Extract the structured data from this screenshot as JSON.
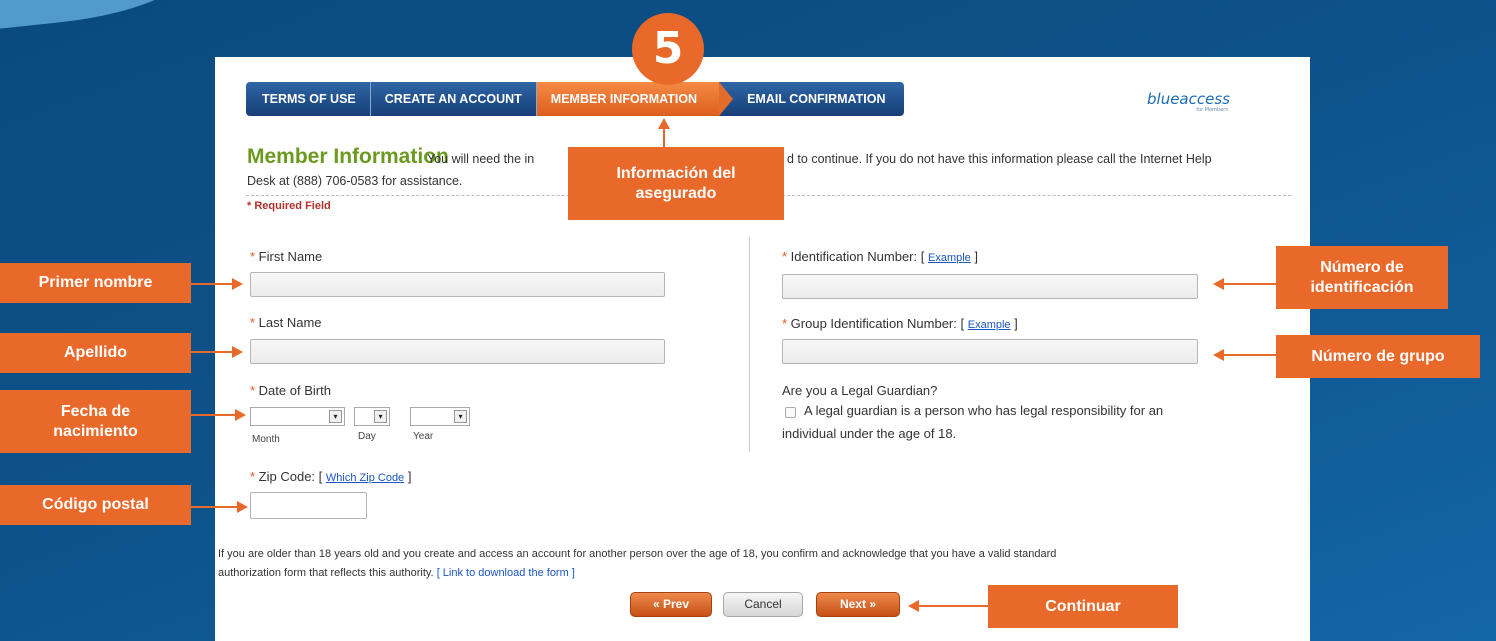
{
  "step": {
    "number": "5"
  },
  "tabs": [
    {
      "label": "TERMS OF USE"
    },
    {
      "label": "CREATE AN ACCOUNT"
    },
    {
      "label": "MEMBER INFORMATION"
    },
    {
      "label": "EMAIL CONFIRMATION"
    }
  ],
  "logo": {
    "text": "blueaccess",
    "tagline": "for Members"
  },
  "header": {
    "title": "Member Information",
    "intro_part1": "You will need the in",
    "intro_part2": "d to continue. If you do not have this information please call the Internet Help",
    "intro_line2": "Desk at (888) 706-0583 for assistance.",
    "required_note": "* Required Field"
  },
  "form": {
    "first_name_label": "First Name",
    "last_name_label": "Last Name",
    "dob_label": "Date of Birth",
    "dob_month": "Month",
    "dob_day": "Day",
    "dob_year": "Year",
    "zip_label": "Zip Code:",
    "zip_link": "Which Zip Code",
    "id_label": "Identification Number:",
    "id_link": "Example",
    "group_label": "Group Identification Number:",
    "group_link": "Example",
    "guardian_question": "Are you a Legal Guardian?",
    "guardian_desc_line1": "A legal guardian is a person who has legal responsibility for an",
    "guardian_desc_line2": "individual under the age of 18.",
    "consent_line1": "If you are older than 18 years old and you create and access an account for another person over the age of 18, you confirm and acknowledge that you have a valid standard",
    "consent_line2": "authorization form that reflects this authority.",
    "consent_link": "[ Link to download the form ]"
  },
  "buttons": {
    "prev": "« Prev",
    "cancel": "Cancel",
    "next": "Next »"
  },
  "callouts": {
    "member_info": "Información del asegurado",
    "first_name": "Primer nombre",
    "last_name": "Apellido",
    "dob": "Fecha de nacimiento",
    "zip": "Código postal",
    "id_number": "Número de identificación",
    "group_number": "Número de grupo",
    "continue": "Continuar"
  },
  "colors": {
    "accent": "#e8692a",
    "tab_blue": "#1f4f8c",
    "title_green": "#6c9a1f",
    "background": "#0d5289"
  }
}
